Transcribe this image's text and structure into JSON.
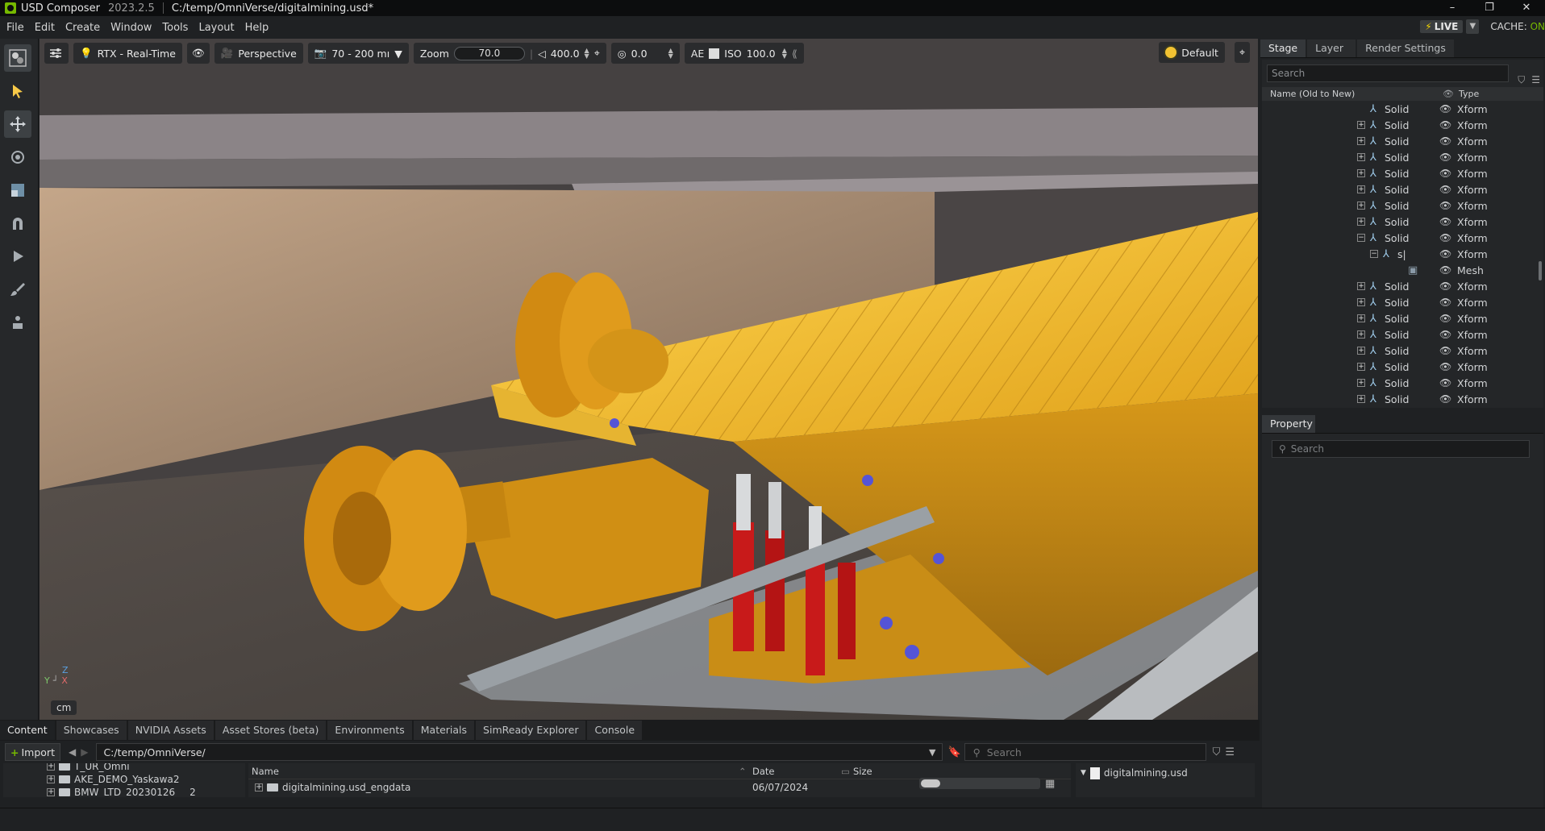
{
  "titlebar": {
    "app": "USD Composer",
    "version": "2023.2.5",
    "path": "C:/temp/OmniVerse/digitalmining.usd*",
    "minimize": "–",
    "restore": "❐",
    "close": "✕"
  },
  "menu": {
    "items": [
      "File",
      "Edit",
      "Create",
      "Window",
      "Tools",
      "Layout",
      "Help"
    ],
    "live": "LIVE",
    "cache_label": "CACHE:",
    "cache_state": "ON"
  },
  "viewport": {
    "renderer": "RTX - Real-Time",
    "camera": "Perspective",
    "lens": "70 - 200 mı",
    "zoom_label": "Zoom",
    "zoom_value": "70.0",
    "focal_value": "400.0",
    "exposure_value": "0.0",
    "ae_label": "AE",
    "iso_label": "ISO",
    "iso_value": "100.0",
    "lighting": "Default",
    "axis_z": "Z",
    "axis_y": "Y",
    "axis_x": "X",
    "unit": "cm"
  },
  "stage": {
    "tabs": [
      "Stage",
      "Layer",
      "Render Settings"
    ],
    "search_placeholder": "Search",
    "col_name": "Name (Old to New)",
    "col_type": "Type",
    "rows": [
      {
        "state": "",
        "label": "Solid",
        "type": "Xform"
      },
      {
        "state": "+",
        "label": "Solid",
        "type": "Xform"
      },
      {
        "state": "+",
        "label": "Solid",
        "type": "Xform"
      },
      {
        "state": "+",
        "label": "Solid",
        "type": "Xform"
      },
      {
        "state": "+",
        "label": "Solid",
        "type": "Xform"
      },
      {
        "state": "+",
        "label": "Solid",
        "type": "Xform"
      },
      {
        "state": "+",
        "label": "Solid",
        "type": "Xform"
      },
      {
        "state": "+",
        "label": "Solid",
        "type": "Xform"
      },
      {
        "state": "−",
        "label": "Solid",
        "type": "Xform"
      },
      {
        "state": "−",
        "label": "s|",
        "type": "Xform",
        "indent": 1
      },
      {
        "state": "",
        "label": "",
        "type": "Mesh",
        "indent": 2
      },
      {
        "state": "+",
        "label": "Solid",
        "type": "Xform"
      },
      {
        "state": "+",
        "label": "Solid",
        "type": "Xform"
      },
      {
        "state": "+",
        "label": "Solid",
        "type": "Xform"
      },
      {
        "state": "+",
        "label": "Solid",
        "type": "Xform"
      },
      {
        "state": "+",
        "label": "Solid",
        "type": "Xform"
      },
      {
        "state": "+",
        "label": "Solid",
        "type": "Xform"
      },
      {
        "state": "+",
        "label": "Solid",
        "type": "Xform"
      },
      {
        "state": "+",
        "label": "Solid",
        "type": "Xform"
      },
      {
        "state": "+",
        "label": "Solid",
        "type": "Xform"
      }
    ]
  },
  "property": {
    "tab": "Property",
    "search_placeholder": "Search"
  },
  "content": {
    "tabs": [
      "Content",
      "Showcases",
      "NVIDIA Assets",
      "Asset Stores (beta)",
      "Environments",
      "Materials",
      "SimReady Explorer",
      "Console"
    ],
    "import_label": "Import",
    "path": "C:/temp/OmniVerse/",
    "search_placeholder": "Search",
    "folders": [
      "T_UR_Omni",
      "AKE_DEMO_Yaskawa2",
      "BMW_LTD_20230126___2"
    ],
    "col_name": "Name",
    "col_date": "Date",
    "col_size": "Size",
    "file_name": "digitalmining.usd_engdata",
    "file_date": "06/07/2024",
    "detail_file": "digitalmining.usd"
  }
}
